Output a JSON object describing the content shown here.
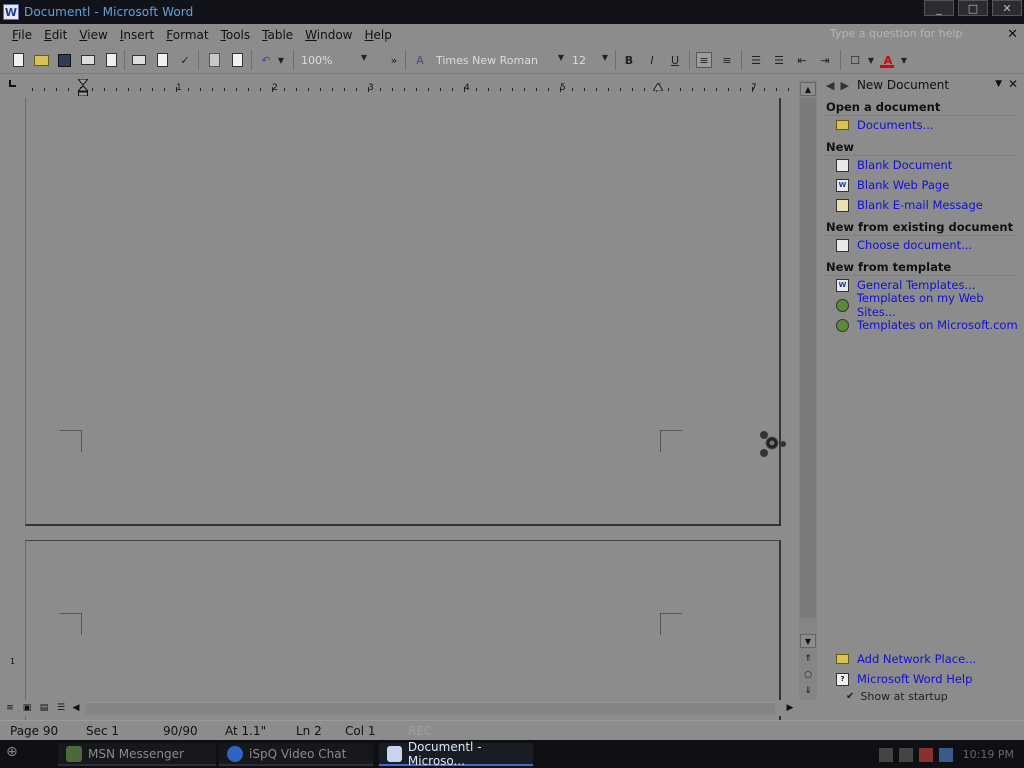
{
  "window": {
    "title": "Documentl - Microsoft Word",
    "app_icon": "W",
    "min_label": "_",
    "max_label": "□",
    "close_label": "✕"
  },
  "menu": {
    "items": [
      "File",
      "Edit",
      "View",
      "Insert",
      "Format",
      "Tools",
      "Table",
      "Window",
      "Help"
    ],
    "help_placeholder": "Type a question for help",
    "close_doc": "✕"
  },
  "toolbar": {
    "zoom": "100%",
    "font": "Times New Roman",
    "size": "12",
    "bold": "B",
    "italic": "I",
    "underline": "U",
    "overflow": "»",
    "font_color_letter": "A",
    "colors": {
      "font_color": "#e00000"
    }
  },
  "ruler": {
    "numbers": [
      "1",
      "2",
      "3",
      "4",
      "5",
      "6",
      "7"
    ]
  },
  "taskpane": {
    "title": "New Document",
    "sections": {
      "open": {
        "title": "Open a document",
        "items": [
          "Documents..."
        ]
      },
      "new": {
        "title": "New",
        "items": [
          "Blank Document",
          "Blank Web Page",
          "Blank E-mail Message"
        ]
      },
      "existing": {
        "title": "New from existing document",
        "items": [
          "Choose document..."
        ]
      },
      "template": {
        "title": "New from template",
        "items": [
          "General Templates...",
          "Templates on my Web Sites...",
          "Templates on Microsoft.com"
        ]
      }
    },
    "bottom": [
      "Add Network Place...",
      "Microsoft Word Help"
    ],
    "show_startup": "Show at startup",
    "link_color": "#1010d6"
  },
  "status": {
    "page": "Page  90",
    "sec": "Sec  1",
    "pages": "90/90",
    "at": "At  1.1\"",
    "ln": "Ln  2",
    "col": "Col  1",
    "rec": "REC"
  },
  "taskbar": {
    "buttons": [
      "MSN Messenger",
      "iSpQ Video Chat",
      "Documentl - Microso..."
    ],
    "clock": "10:19 PM",
    "active_color": "#3b6bd6"
  }
}
